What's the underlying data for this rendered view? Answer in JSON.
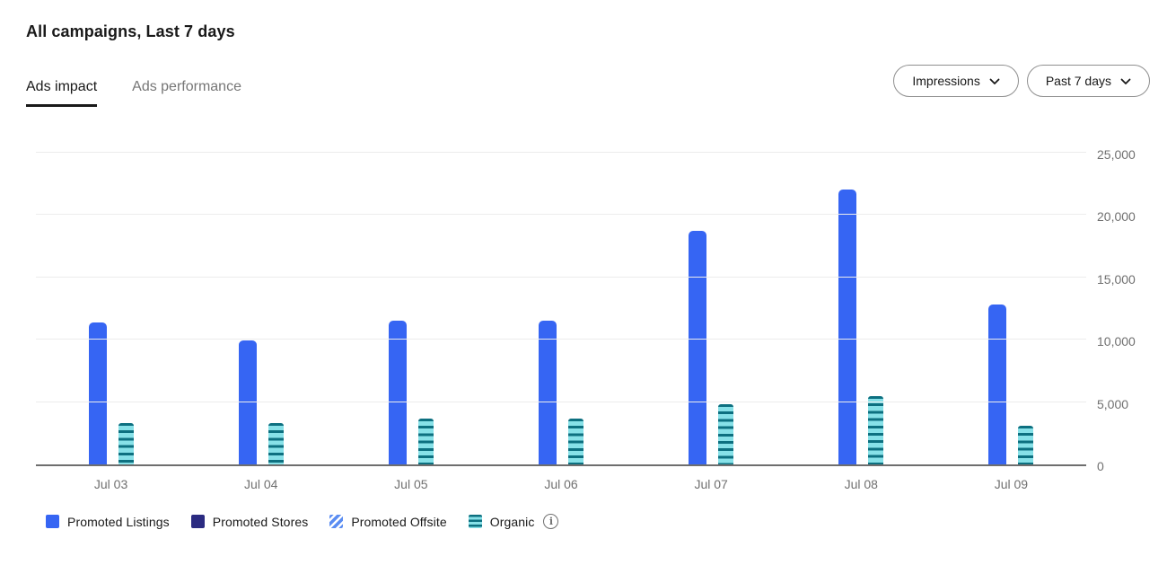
{
  "header": {
    "title": "All campaigns, Last 7 days"
  },
  "tabs": [
    {
      "label": "Ads impact",
      "active": true
    },
    {
      "label": "Ads performance",
      "active": false
    }
  ],
  "controls": {
    "metric_dropdown": {
      "label": "Impressions"
    },
    "range_dropdown": {
      "label": "Past 7 days"
    }
  },
  "chart_data": {
    "type": "bar",
    "title": "All campaigns, Last 7 days — Impressions",
    "categories": [
      "Jul 03",
      "Jul 04",
      "Jul 05",
      "Jul 06",
      "Jul 07",
      "Jul 08",
      "Jul 09"
    ],
    "series": [
      {
        "name": "Promoted Listings",
        "slug": "promoted-listings",
        "pattern": "solid",
        "color": "#3665f3",
        "values": [
          11400,
          9900,
          11500,
          11500,
          18700,
          22000,
          12800
        ]
      },
      {
        "name": "Promoted Stores",
        "slug": "promoted-stores",
        "pattern": "solid",
        "color": "#2b2b81",
        "values": [
          0,
          0,
          0,
          0,
          0,
          0,
          0
        ]
      },
      {
        "name": "Promoted Offsite",
        "slug": "promoted-offsite",
        "pattern": "diagonal-stripes",
        "color": "#5b8df2",
        "stripe_color": "#ffffff",
        "values": [
          0,
          0,
          0,
          0,
          0,
          0,
          0
        ]
      },
      {
        "name": "Organic",
        "slug": "organic",
        "pattern": "horizontal-stripes",
        "color": "#87e1e8",
        "stripe_color": "#0d7080",
        "has_info": true,
        "values": [
          3300,
          3300,
          3650,
          3650,
          4800,
          5500,
          3100
        ]
      }
    ],
    "ticks": [
      {
        "label": "25,000",
        "value": 25000
      },
      {
        "label": "20,000",
        "value": 20000
      },
      {
        "label": "15,000",
        "value": 15000
      },
      {
        "label": "10,000",
        "value": 10000
      },
      {
        "label": "5,000",
        "value": 5000
      },
      {
        "label": "0",
        "value": 0
      }
    ],
    "ylim": [
      0,
      25000
    ],
    "xlabel": "",
    "ylabel": "",
    "grid": "horizontal",
    "legend_position": "bottom",
    "colors": {
      "axis_line": "#6e6e6e",
      "gridline": "#ececec",
      "tick_text": "#707070"
    }
  }
}
